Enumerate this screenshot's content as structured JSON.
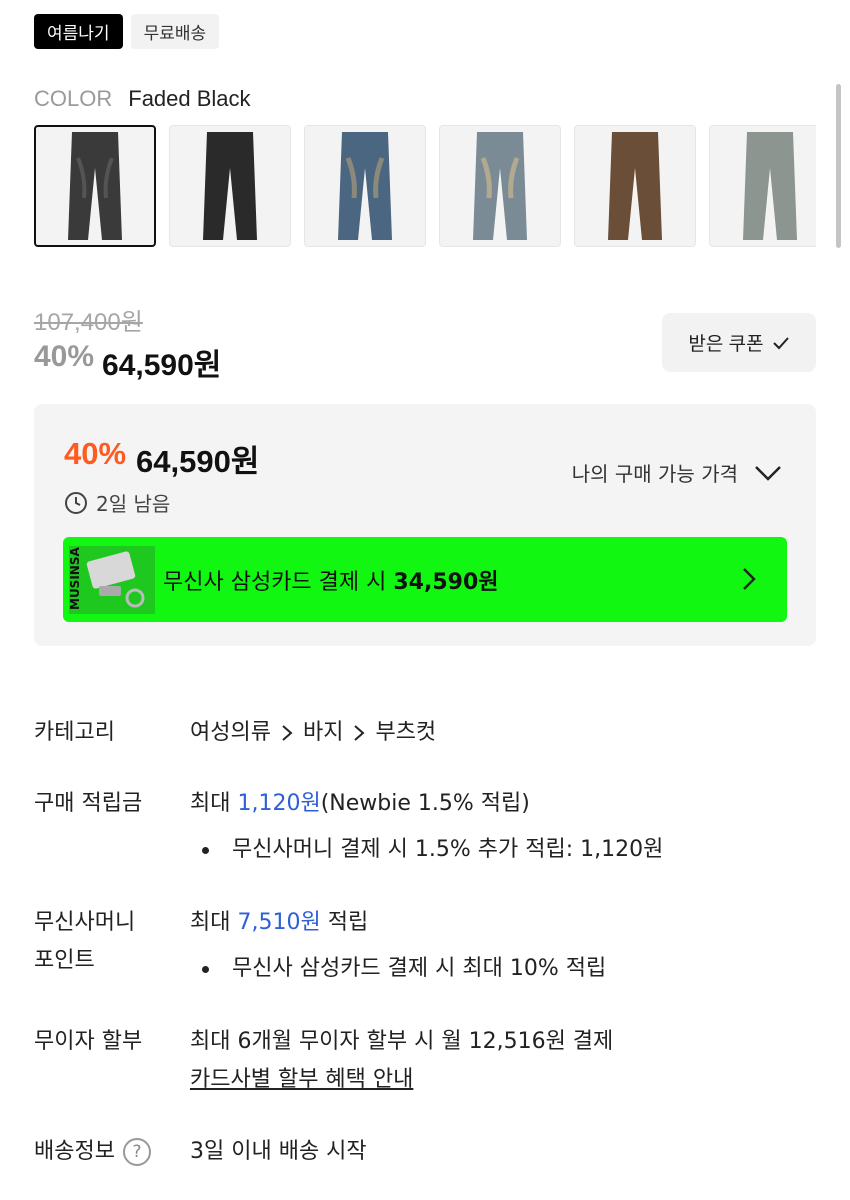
{
  "tags": [
    "여름나기",
    "무료배송"
  ],
  "color": {
    "label": "COLOR",
    "value": "Faded Black"
  },
  "thumbnails": [
    {
      "name": "Faded Black",
      "color": "#3a3a3a"
    },
    {
      "name": "Black",
      "color": "#2a2a2a"
    },
    {
      "name": "Blue",
      "color": "#4a6680"
    },
    {
      "name": "Light Blue",
      "color": "#7a8b96"
    },
    {
      "name": "Brown",
      "color": "#6a4e38"
    },
    {
      "name": "Grey",
      "color": "#8c9590"
    }
  ],
  "price": {
    "original": "107,400원",
    "discount": "40%",
    "sale": "64,590원",
    "coupon_button": "받은 쿠폰"
  },
  "price_box": {
    "discount": "40%",
    "sale": "64,590원",
    "time_left": "2일 남음",
    "my_price_label": "나의 구매 가능 가격",
    "banner_text": "무신사 삼성카드 결제 시",
    "banner_price": "34,590원",
    "banner_brand": "MUSINSA"
  },
  "info": {
    "category": {
      "label": "카테고리",
      "path": [
        "여성의류",
        "바지",
        "부츠컷"
      ]
    },
    "points": {
      "label": "구매 적립금",
      "prefix": "최대",
      "amount": "1,120원",
      "suffix": "(Newbie 1.5% 적립)",
      "bullet": "무신사머니 결제 시 1.5% 추가 적립: 1,120원"
    },
    "money": {
      "label_line1": "무신사머니",
      "label_line2": "포인트",
      "prefix": "최대",
      "amount": "7,510원",
      "suffix": "적립",
      "bullet": "무신사 삼성카드 결제 시 최대 10% 적립"
    },
    "installment": {
      "label": "무이자 할부",
      "text": "최대 6개월 무이자 할부 시 월 12,516원 결제",
      "link": "카드사별 할부 혜택 안내"
    },
    "shipping": {
      "label": "배송정보",
      "text": "3일 이내 배송 시작"
    }
  }
}
